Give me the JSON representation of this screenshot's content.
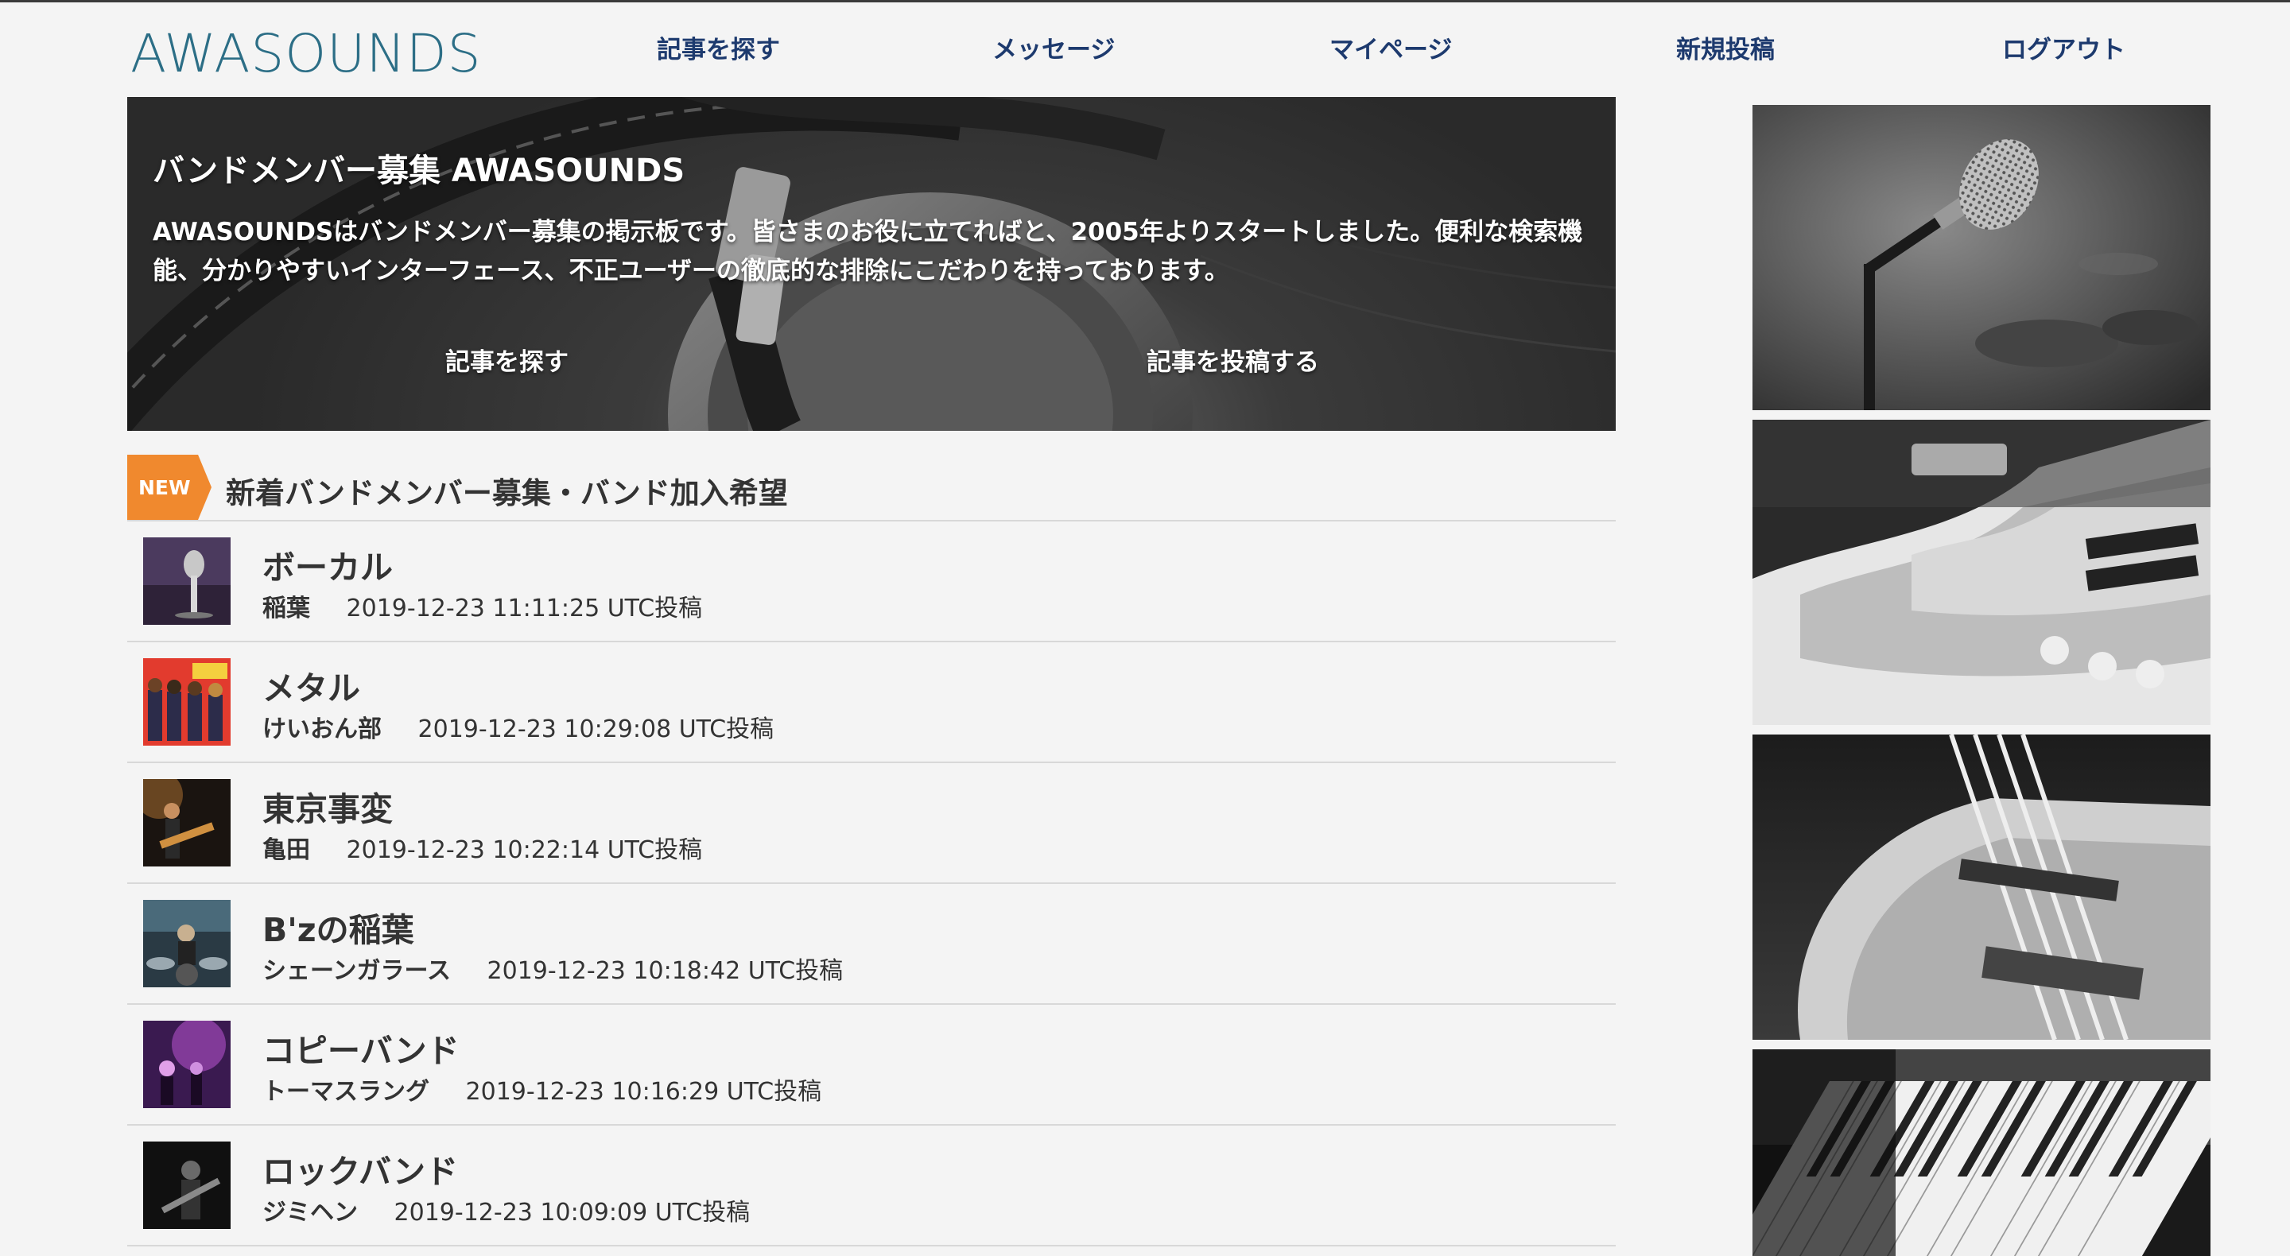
{
  "header": {
    "logo": "AWASOUNDS",
    "nav": [
      {
        "label": "記事を探す"
      },
      {
        "label": "メッセージ"
      },
      {
        "label": "マイページ"
      },
      {
        "label": "新規投稿"
      },
      {
        "label": "ログアウト"
      }
    ]
  },
  "hero": {
    "title": "バンドメンバー募集 AWASOUNDS",
    "description": "AWASOUNDSはバンドメンバー募集の掲示板です。皆さまのお役に立てればと、2005年よりスタートしました。便利な検索機能、分かりやすいインターフェース、不正ユーザーの徹底的な排除にこだわりを持っております。",
    "search_button": "記事を探す",
    "post_button": "記事を投稿する"
  },
  "section": {
    "badge": "NEW",
    "title": "新着バンドメンバー募集・バンド加入希望"
  },
  "posts": [
    {
      "title": "ボーカル",
      "author": "稲葉",
      "posted": "2019-12-23 11:11:25 UTC投稿",
      "thumb_icon": "microphone-thumbnail"
    },
    {
      "title": "メタル",
      "author": "けいおん部",
      "posted": "2019-12-23 10:29:08 UTC投稿",
      "thumb_icon": "anime-band-thumbnail"
    },
    {
      "title": "東京事変",
      "author": "亀田",
      "posted": "2019-12-23 10:22:14 UTC投稿",
      "thumb_icon": "guitarist-thumbnail"
    },
    {
      "title": "B'zの稲葉",
      "author": "シェーンガラース",
      "posted": "2019-12-23 10:18:42 UTC投稿",
      "thumb_icon": "drummer-thumbnail"
    },
    {
      "title": "コピーバンド",
      "author": "トーマスラング",
      "posted": "2019-12-23 10:16:29 UTC投稿",
      "thumb_icon": "concert-thumbnail"
    },
    {
      "title": "ロックバンド",
      "author": "ジミヘン",
      "posted": "2019-12-23 10:09:09 UTC投稿",
      "thumb_icon": "rock-guitar-thumbnail"
    }
  ],
  "sidebar": {
    "images": [
      "microphone-photo",
      "electric-guitar-photo",
      "bass-guitar-photo",
      "piano-keys-photo"
    ]
  },
  "colors": {
    "logo": "#2c6e86",
    "nav": "#1d3a6e",
    "badge": "#f0892e",
    "page_bg": "#f4f4f4"
  }
}
